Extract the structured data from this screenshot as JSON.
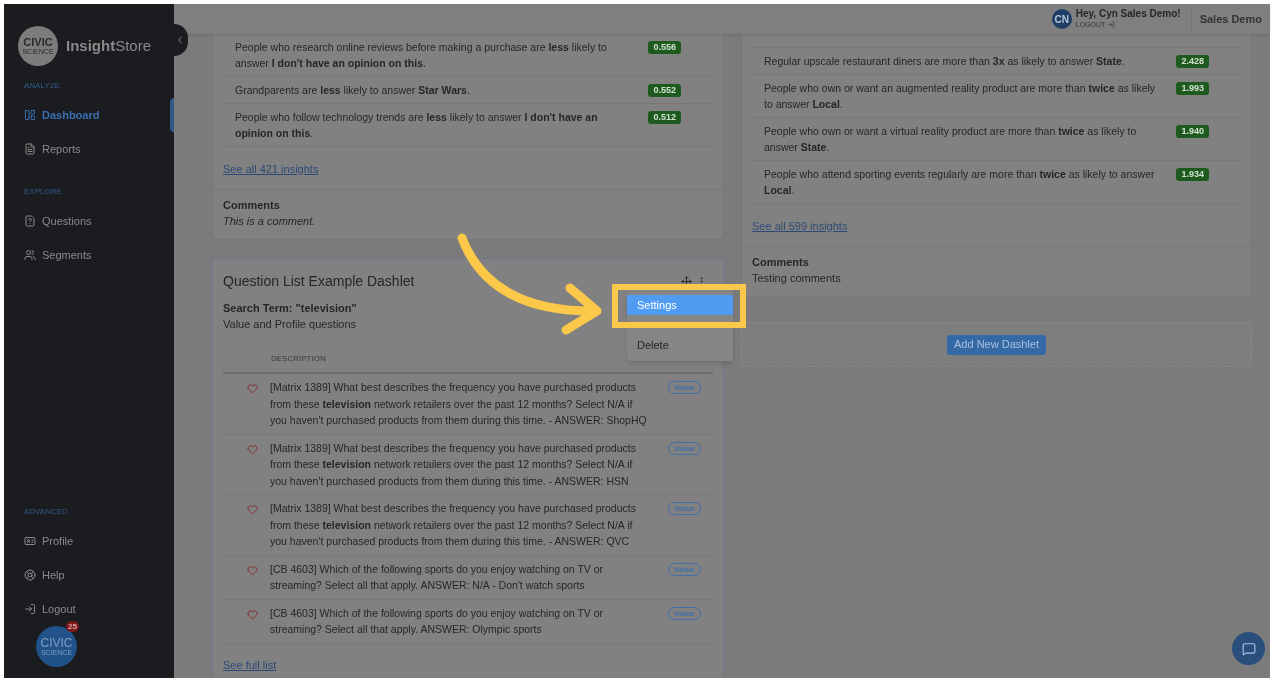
{
  "sidebar": {
    "logo": {
      "line1": "CIVIC",
      "line2": "SCIENCE"
    },
    "brand": "**Insight**Store",
    "sections": [
      {
        "label": "ANALYZE",
        "items": [
          {
            "label": "Dashboard",
            "selected": true
          },
          {
            "label": "Reports",
            "selected": false
          }
        ]
      },
      {
        "label": "EXPLORE",
        "items": [
          {
            "label": "Questions",
            "selected": false
          },
          {
            "label": "Segments",
            "selected": false
          }
        ]
      },
      {
        "label": "ADVANCED",
        "items": [
          {
            "label": "Profile",
            "selected": false
          },
          {
            "label": "Help",
            "selected": false
          },
          {
            "label": "Logout",
            "selected": false
          }
        ]
      }
    ],
    "chat_badge": {
      "line1": "CIVIC",
      "line2": "SCIENCE",
      "count": "25"
    }
  },
  "header": {
    "user": {
      "initials": "CN",
      "greeting": "Hey, Cyn Sales Demo!",
      "logout": "LOGOUT"
    },
    "account": "Sales Demo"
  },
  "left_insights": {
    "insights": [
      {
        "text": "People who research online reviews before making a purchase are **less** likely to answer **I don't have an opinion on this**.",
        "score": "0.556"
      },
      {
        "text": "Grandparents are **less** likely to answer **Star Wars**.",
        "score": "0.552"
      },
      {
        "text": "People who follow technology trends are **less** likely to answer **I don't have an opinion on this**.",
        "score": "0.512"
      }
    ],
    "link": "See all 421 insights",
    "comments": {
      "title": "Comments",
      "text": "This is a comment.",
      "italic": true
    }
  },
  "question_dashlet": {
    "title": "Question List Example Dashlet",
    "search_term": "Search Term: \"television\"",
    "subtitle": "Value and Profile questions",
    "column": "DESCRIPTION",
    "rows": [
      {
        "text": "[Matrix 1389] What best describes the frequency you have purchased products from these **television** network retailers over the past 12 months? Select N/A if you haven't purchased products from them during this time. - ANSWER: ShopHQ",
        "tag": "Value",
        "favorite": false
      },
      {
        "text": "[Matrix 1389] What best describes the frequency you have purchased products from these **television** network retailers over the past 12 months? Select N/A if you haven't purchased products from them during this time. - ANSWER: HSN",
        "tag": "Value",
        "favorite": false
      },
      {
        "text": "[Matrix 1389] What best describes the frequency you have purchased products from these **television** network retailers over the past 12 months? Select N/A if you haven't purchased products from them during this time. - ANSWER: QVC",
        "tag": "Value",
        "favorite": false
      },
      {
        "text": "[CB 4603] Which of the following sports do you enjoy watching on TV or streaming? Select all that apply. ANSWER: N/A - Don't watch sports",
        "tag": "Value",
        "favorite": false
      },
      {
        "text": "[CB 4603] Which of the following sports do you enjoy watching on TV or streaming? Select all that apply. ANSWER: Olympic sports",
        "tag": "Value",
        "favorite": false
      }
    ],
    "link": "See full list",
    "menu": [
      {
        "label": "Settings",
        "selected": true
      },
      {
        "label": "Delete",
        "selected": false
      }
    ]
  },
  "right_insights": {
    "insights": [
      {
        "text": "Regular upscale restaurant diners are more than **3x** as likely to answer **State**.",
        "score": "2.428"
      },
      {
        "text": "People who own or want an augmented reality product are more than **twice** as likely to answer **Local**.",
        "score": "1.993"
      },
      {
        "text": "People who own or want a virtual reality product are more than **twice** as likely to answer **State**.",
        "score": "1.940"
      },
      {
        "text": "People who attend sporting events regularly are more than **twice** as likely to answer **Local**.",
        "score": "1.934"
      }
    ],
    "link": "See all 599 insights",
    "comments": {
      "title": "Comments",
      "text": "Testing comments",
      "italic": false
    }
  },
  "add_dashlet": {
    "label": "Add New Dashlet"
  }
}
